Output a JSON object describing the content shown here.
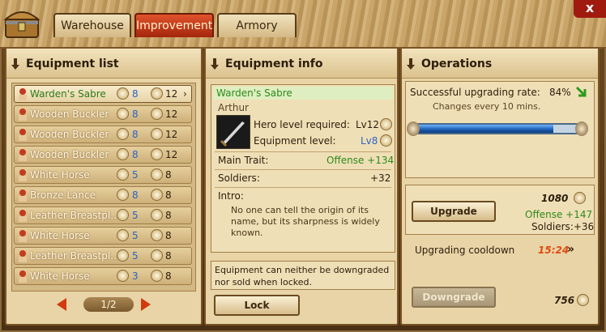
{
  "tabs": [
    "Warehouse",
    "Improvement",
    "Armory"
  ],
  "close_label": "x",
  "equipment_list": {
    "title": "Equipment list",
    "items": [
      {
        "name": "Warden's Sabre",
        "level": "8",
        "value": "12",
        "trait_icon": "sword-icon",
        "selected": true
      },
      {
        "name": "Wooden Buckler",
        "level": "8",
        "value": "12",
        "trait_icon": "shield-icon"
      },
      {
        "name": "Wooden Buckler",
        "level": "8",
        "value": "12",
        "trait_icon": "shield-icon"
      },
      {
        "name": "Wooden Buckler",
        "level": "8",
        "value": "12",
        "trait_icon": "shield-icon"
      },
      {
        "name": "White Horse",
        "level": "5",
        "value": "8",
        "trait_icon": "horse-icon"
      },
      {
        "name": "Bronze Lance",
        "level": "8",
        "value": "8",
        "trait_icon": "sword-icon"
      },
      {
        "name": "Leather Breastpl...",
        "level": "5",
        "value": "8",
        "trait_icon": "armor-icon"
      },
      {
        "name": "White Horse",
        "level": "5",
        "value": "8",
        "trait_icon": "horse-icon"
      },
      {
        "name": "Leather Breastpl...",
        "level": "5",
        "value": "8",
        "trait_icon": "armor-icon"
      },
      {
        "name": "White Horse",
        "level": "3",
        "value": "8",
        "trait_icon": "horse-icon"
      }
    ],
    "page": "1/2"
  },
  "equipment_info": {
    "title": "Equipment info",
    "item_name": "Warden's Sabre",
    "owner": "Arthur",
    "hero_level_label": "Hero level required:",
    "hero_level_value": "Lv12",
    "equip_level_label": "Equipment level:",
    "equip_level_value": "Lv8",
    "main_trait_label": "Main Trait:",
    "main_trait_value": "Offense +134",
    "soldiers_label": "Soldiers:",
    "soldiers_value": "+32",
    "intro_label": "Intro:",
    "intro_text": "No one can tell the origin of its name, but its sharpness is widely known.",
    "lock_note": "Equipment can neither be downgraded nor sold when locked.",
    "lock_button": "Lock"
  },
  "operations": {
    "title": "Operations",
    "rate_label": "Successful upgrading rate:",
    "rate_value": "84%",
    "rate_note": "Changes every 10 mins.",
    "rate_fraction": 0.84,
    "upgrade_cost": "1080",
    "upgrade_button": "Upgrade",
    "upgrade_offense": "Offense +147",
    "upgrade_soldiers": "Soldiers:+36",
    "cooldown_label": "Upgrading cooldown",
    "cooldown_value": "15:24",
    "downgrade_button": "Downgrade",
    "downgrade_cost": "756"
  },
  "colors": {
    "accent_green": "#2d8a1c",
    "level_blue": "#2a64c4",
    "cooldown": "#e04a10"
  }
}
